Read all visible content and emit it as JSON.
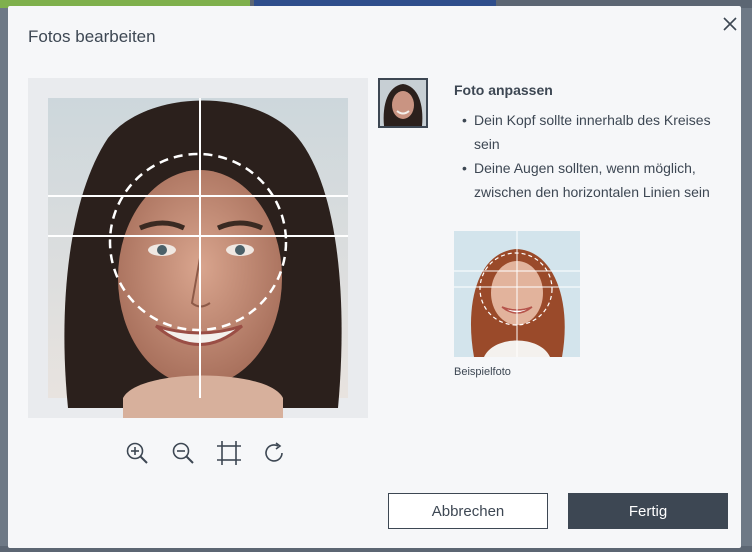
{
  "dialog": {
    "title": "Fotos bearbeiten",
    "close_icon": "close-icon"
  },
  "editor": {
    "tools": [
      {
        "name": "zoom-in-icon"
      },
      {
        "name": "zoom-out-icon"
      },
      {
        "name": "crop-icon"
      },
      {
        "name": "rotate-icon"
      }
    ]
  },
  "tips": {
    "title": "Foto anpassen",
    "items": [
      "Dein Kopf sollte innerhalb des Kreises sein",
      "Deine Augen sollten, wenn möglich, zwischen den horizontalen Linien sein"
    ]
  },
  "example": {
    "label": "Beispielfoto"
  },
  "actions": {
    "cancel_label": "Abbrechen",
    "done_label": "Fertig"
  },
  "colors": {
    "primary": "#3d4753",
    "background": "#f6f7f9"
  }
}
